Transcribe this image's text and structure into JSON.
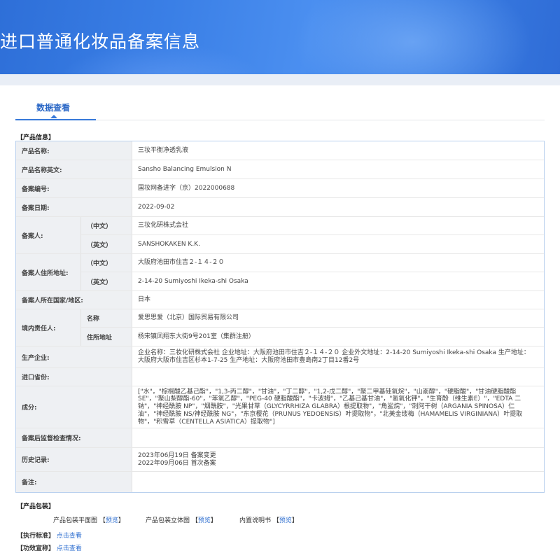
{
  "page_title": "进口普通化妆品备案信息",
  "tab": {
    "label": "数据查看"
  },
  "product_info_heading": "【产品信息】",
  "fields": {
    "product_name": {
      "label": "产品名称:",
      "value": "三妆平衡净透乳液"
    },
    "product_name_en": {
      "label": "产品名称英文:",
      "value": "Sansho Balancing Emulsion N"
    },
    "record_no": {
      "label": "备案编号:",
      "value": "国妆网备进字（京）2022000688"
    },
    "record_date": {
      "label": "备案日期:",
      "value": "2022-09-02"
    },
    "filer": {
      "label": "备案人:",
      "cn_label": "（中文）",
      "cn_value": "三妆化研株式会社",
      "en_label": "（英文）",
      "en_value": "SANSHOKAKEN K.K."
    },
    "filer_address": {
      "label": "备案人住所地址:",
      "cn_label": "（中文）",
      "cn_value": "大阪府池田市住吉２-１４-２０",
      "en_label": "（英文）",
      "en_value": "2-14-20 Sumiyoshi Ikeka-shi Osaka"
    },
    "country": {
      "label": "备案人所在国家/地区:",
      "value": "日本"
    },
    "domestic_agent": {
      "label": "境内责任人:",
      "name_label": "名称",
      "name_value": "爱思思爱（北京）国际贸易有限公司",
      "addr_label": "住所地址",
      "addr_value": "杨宋镇凤翔东大街9号201室（集群注册）"
    },
    "manufacturer": {
      "label": "生产企业:",
      "value": "企业名称：三妆化研株式会社 企业地址：大阪府池田市住吉２-１４-２０ 企业外文地址：2-14-20 Sumiyoshi Ikeka-shi Osaka 生产地址：大阪府大阪市住吉区杉本1-7-25 生产地址：大阪府池田市豊島南2丁目12番2号"
    },
    "import_port": {
      "label": "进口省份:",
      "value": ""
    },
    "ingredients": {
      "label": "成分:",
      "value": "[\"水\"，\"棕榈酸乙基己酯\"，\"1,3-丙二醇\"，\"甘油\"，\"丁二醇\"，\"1,2-戊二醇\"，\"聚二甲基硅氧烷\"，\"山嵛醇\"，\"硬脂酸\"，\"甘油硬脂酸酯SE\"，\"聚山梨醇酯-60\"，\"苯氧乙醇\"，\"PEG-40 硬脂酸酯\"，\"卡波姆\"，\"乙基己基甘油\"，\"氢氧化钾\"，\"生育酚（维生素E）\"，\"EDTA 二钠\"，\"神经酰胺 NP\"，\"烟酰胺\"，\"光果甘草（GLYCYRRHIZA GLABRA）根提取物\"，\"角鲨烷\"，\"刺阿干树（ARGANIA SPINOSA）仁油\"，\"神经酰胺 NS/神经酰胺 NG\"，\"东京樱花（PRUNUS YEDOENSIS）叶提取物\"，\"北美金缕梅（HAMAMELIS VIRGINIANA）叶提取物\"，\"积雪草（CENTELLA ASIATICA）提取物\"]"
    },
    "post_check": {
      "label": "备案后监督检查情况:",
      "value": ""
    },
    "history": {
      "label": "历史记录:",
      "line1": "2023年06月19日 备案变更",
      "line2": "2022年09月06日 首次备案"
    },
    "remarks": {
      "label": "备注:",
      "value": ""
    }
  },
  "packaging": {
    "heading": "【产品包装】",
    "items": [
      {
        "name": "产品包装平面图",
        "link": "预览"
      },
      {
        "name": "产品包装立体图",
        "link": "预览"
      },
      {
        "name": "内置说明书",
        "link": "预览"
      }
    ]
  },
  "standard": {
    "heading": "【执行标准】",
    "link": "点击查看"
  },
  "efficacy": {
    "heading": "【功效宣称】",
    "link": "点击查看"
  }
}
